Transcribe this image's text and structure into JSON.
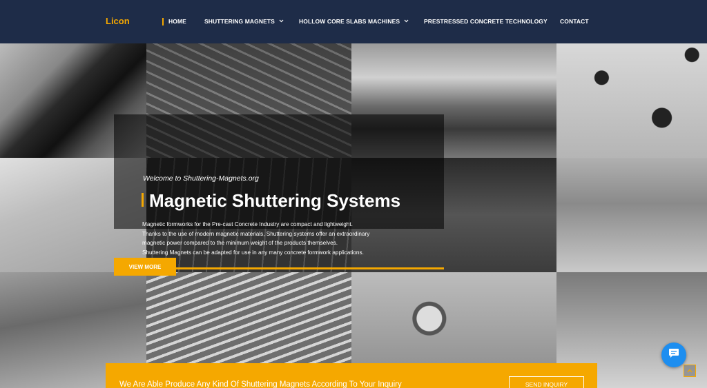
{
  "header": {
    "logo": "Licon",
    "nav": [
      {
        "label": "HOME"
      },
      {
        "label": "SHUTTERING MAGNETS"
      },
      {
        "label": "HOLLOW CORE SLABS MACHINES"
      },
      {
        "label": "PRESTRESSED CONCRETE TECHNOLOGY"
      },
      {
        "label": "CONTACT"
      }
    ],
    "dropdown_icon": "chevron-down-icon"
  },
  "hero": {
    "welcome": "Welcome to Shuttering-Magnets.org",
    "title": "Magnetic Shuttering Systems",
    "description": [
      "Magnetic formworks for the Pre-cast Concrete Industry are compact and lightweight.",
      "Thanks to the use of modern magnetic materials, Shuttering systems offer an extraordinary",
      "magnetic power compared to the minimum weight of the products themselves.",
      "Shuttering Magnets can be adapted for use in any many concrete formwork applications."
    ],
    "button": "VIEW MORE"
  },
  "cta": {
    "text": "We Are Able Produce Any Kind Of Shuttering Magnets According To Your Inquiry",
    "button": "SEND INQUIRY"
  },
  "widgets": {
    "chat_icon": "chat-bubble-icon",
    "top_icon": "arrow-up-icon"
  },
  "colors": {
    "header_bg": "#1e2c48",
    "accent": "#f5a800",
    "chat": "#1d8ef0"
  }
}
